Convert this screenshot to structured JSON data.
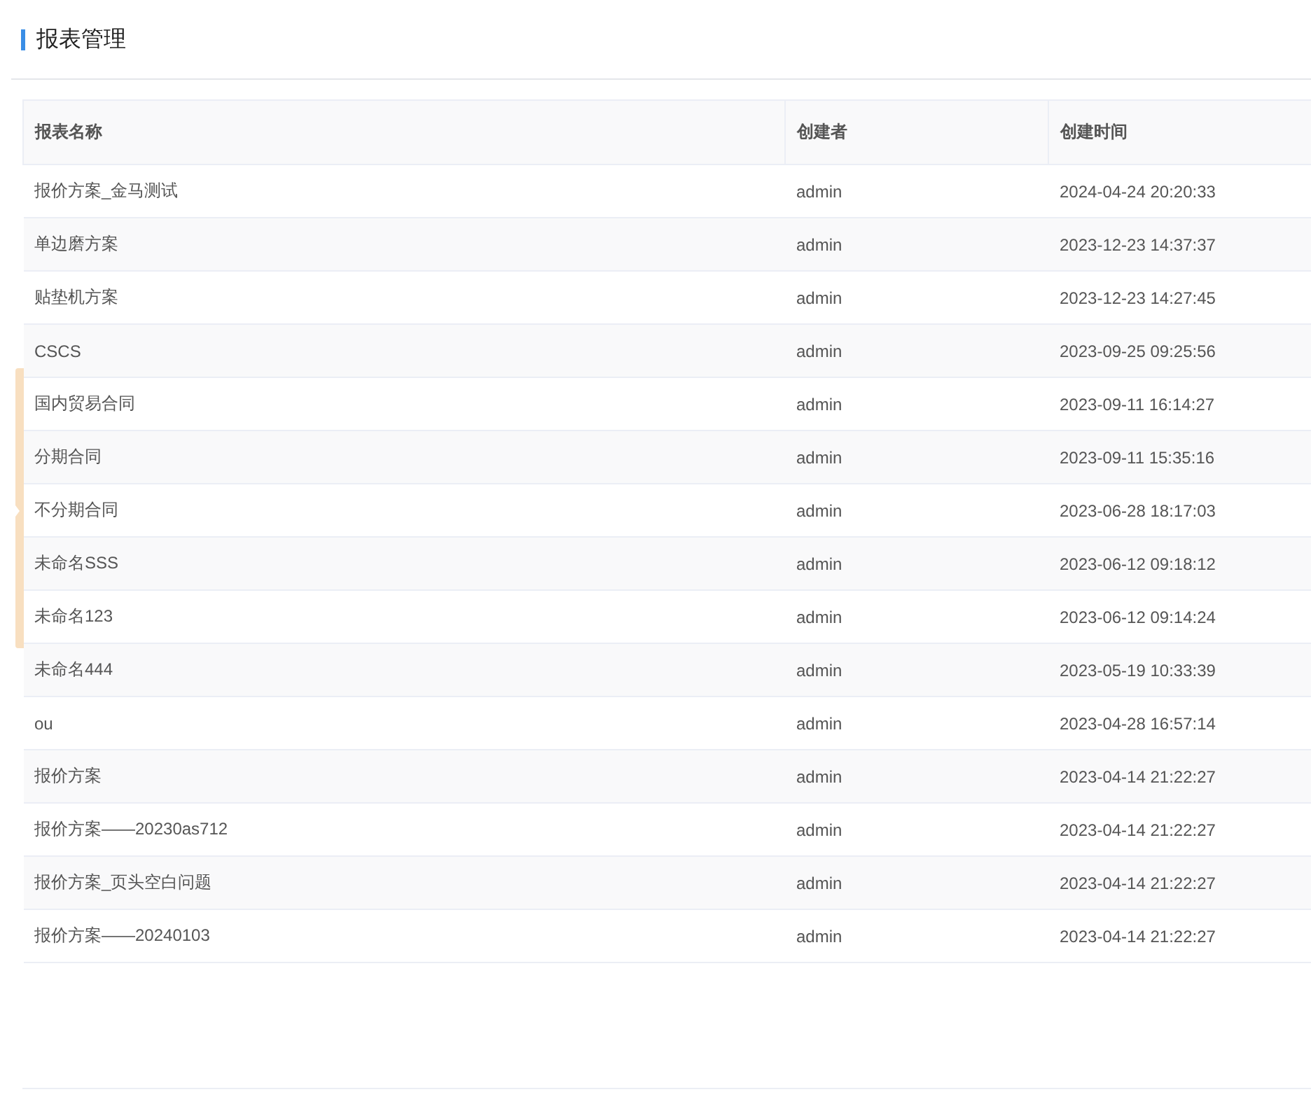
{
  "page": {
    "title": "报表管理"
  },
  "table": {
    "columns": [
      "报表名称",
      "创建者",
      "创建时间"
    ],
    "rows": [
      [
        "报价方案_金马测试",
        "admin",
        "2024-04-24 20:20:33"
      ],
      [
        "单边磨方案",
        "admin",
        "2023-12-23 14:37:37"
      ],
      [
        "贴垫机方案",
        "admin",
        "2023-12-23 14:27:45"
      ],
      [
        "CSCS",
        "admin",
        "2023-09-25 09:25:56"
      ],
      [
        "国内贸易合同",
        "admin",
        "2023-09-11 16:14:27"
      ],
      [
        "分期合同",
        "admin",
        "2023-09-11 15:35:16"
      ],
      [
        "不分期合同",
        "admin",
        "2023-06-28 18:17:03"
      ],
      [
        "未命名SSS",
        "admin",
        "2023-06-12 09:18:12"
      ],
      [
        "未命名123",
        "admin",
        "2023-06-12 09:14:24"
      ],
      [
        "未命名444",
        "admin",
        "2023-05-19 10:33:39"
      ],
      [
        "ou",
        "admin",
        "2023-04-28 16:57:14"
      ],
      [
        "报价方案",
        "admin",
        "2023-04-14 21:22:27"
      ],
      [
        "报价方案——20230as712",
        "admin",
        "2023-04-14 21:22:27"
      ],
      [
        "报价方案_页头空白问题",
        "admin",
        "2023-04-14 21:22:27"
      ],
      [
        "报价方案——20240103",
        "admin",
        "2023-04-14 21:22:27"
      ]
    ]
  }
}
